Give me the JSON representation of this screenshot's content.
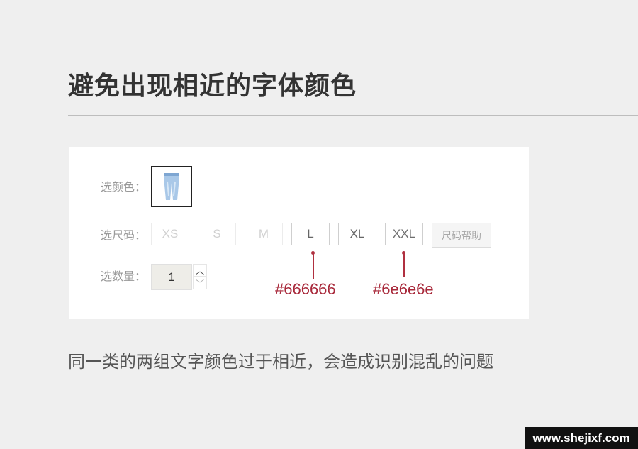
{
  "page": {
    "title": "避免出现相近的字体颜色",
    "caption": "同一类的两组文字颜色过于相近，会造成识别混乱的问题",
    "watermark": "www.shejixf.com"
  },
  "product": {
    "color_label": "选颜色：",
    "size_label": "选尺码：",
    "qty_label": "选数量：",
    "color_swatch_icon": "jeans-thumbnail-icon",
    "sizes": [
      {
        "label": "XS",
        "state": "disabled"
      },
      {
        "label": "S",
        "state": "disabled"
      },
      {
        "label": "M",
        "state": "disabled"
      },
      {
        "label": "L",
        "state": "available",
        "color": "#666666"
      },
      {
        "label": "XL",
        "state": "available",
        "color": "#666666"
      },
      {
        "label": "XXL",
        "state": "available",
        "color": "#6e6e6e"
      }
    ],
    "size_help": "尺码帮助",
    "quantity": "1",
    "qty_up_icon": "chevron-up-icon",
    "qty_down_icon": "chevron-down-icon"
  },
  "annotations": {
    "left": "#666666",
    "right": "#6e6e6e",
    "color": "#a8283a"
  }
}
